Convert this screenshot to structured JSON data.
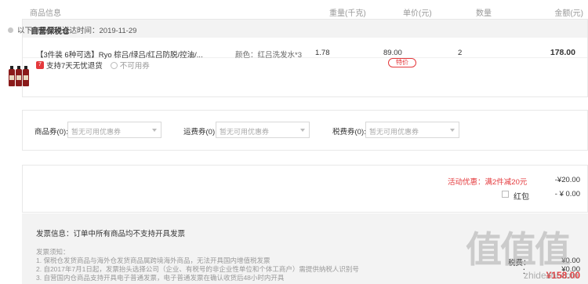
{
  "header": {
    "info": "商品信息",
    "weight": "重量(千克)",
    "price": "单价(元)",
    "qty": "数量",
    "amount": "金额(元)"
  },
  "warehouse": {
    "title": "自营保税仓",
    "ship_time": "以下商品预计送达时间：2019-11-29"
  },
  "item": {
    "name": "【3件装 6种可选】Ryo 棕吕/绿吕/红吕防脱/控油/...",
    "support_badge": "7",
    "support_text": "支持7天无忧退货",
    "coupon_unusable": "不可用券",
    "attr": "颜色：红吕洗发水*3",
    "weight": "1.78",
    "price": "89.00",
    "tag": "特价",
    "qty": "2",
    "amount": "178.00"
  },
  "coupons": {
    "goods_label": "商品券(0):",
    "goods_value": "暂无可用优惠券",
    "shipping_label": "运费券(0):",
    "shipping_value": "暂无可用优惠券",
    "tax_label": "税费券(0):",
    "tax_value": "暂无可用优惠券"
  },
  "discount": {
    "promo_label": "活动优惠：满2件减20元",
    "promo_value": "-¥20.00",
    "redpacket_label": "红包",
    "redpacket_value": "- ¥ 0.00"
  },
  "invoice": {
    "title": "发票信息：订单中所有商品均不支持开具发票",
    "notes_title": "发票须知：",
    "note1": "1. 保税仓发货商品与海外仓发货商品属跨境海外商品，无法开具国内增值税发票",
    "note2": "2. 自2017年7月1日起，发票抬头选择公司（企业、有税号的非企业性单位和个体工商户）需提供纳税人识别号",
    "note3": "3. 自营国内仓商品支持开具电子普通发票，电子普通发票在确认收货后48小时内开具"
  },
  "summary": {
    "row1_label": "",
    "row1_value": "",
    "row2_label": "",
    "row2_value": "",
    "tax_label": "税费：",
    "tax_value": "¥0.00",
    "row4_label": "：",
    "row4_value": "¥0.00",
    "total_label": "",
    "total_value": "¥158.00"
  },
  "watermark": {
    "text": "zhidezhi.com",
    "glyphs": "值值值"
  },
  "colors": {
    "accent": "#e4393c",
    "panel_bg": "#f3f3f3",
    "border": "#e8e8e8"
  }
}
